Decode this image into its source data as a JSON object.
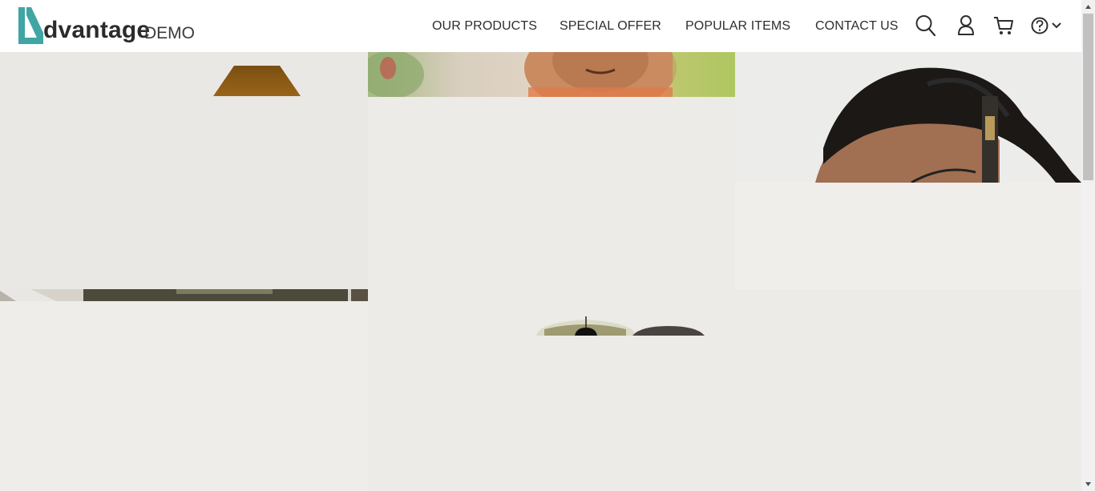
{
  "brand": {
    "name": "dvantage",
    "sub": "DEMO",
    "accent_color": "#3fa6a3"
  },
  "nav": {
    "items": [
      {
        "label": "OUR PRODUCTS"
      },
      {
        "label": "SPECIAL OFFER"
      },
      {
        "label": "POPULAR ITEMS"
      },
      {
        "label": "CONTACT US"
      }
    ]
  },
  "icons": {
    "search": "search-icon",
    "user": "user-icon",
    "cart": "cart-icon",
    "help": "help-icon",
    "chevron": "chevron-down-icon"
  }
}
